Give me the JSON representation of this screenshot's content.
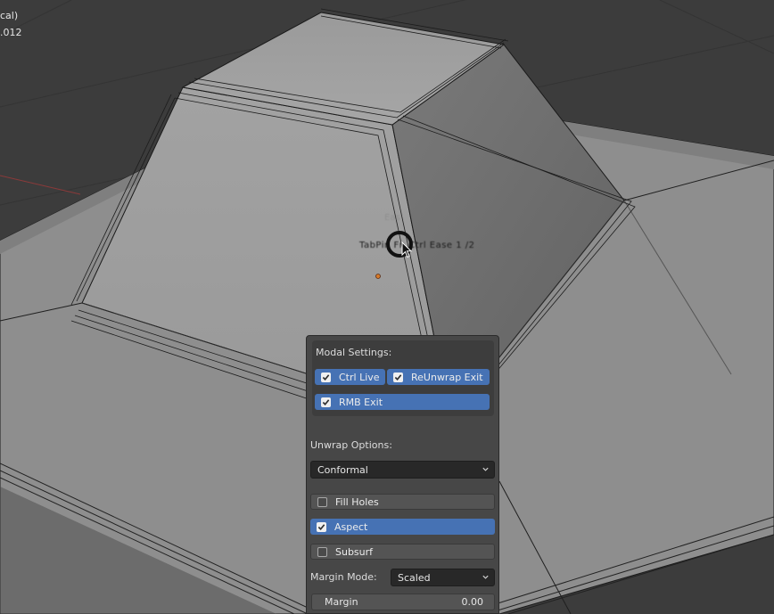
{
  "viewport": {
    "corner_line1": "cal)",
    "corner_line2": ".012",
    "ghost_title": "Eas",
    "ghost_shortcut": "TabPin  Fn Ctrl Ease  1  /2"
  },
  "panel": {
    "modal_settings_label": "Modal Settings:",
    "ctrl_live": {
      "label": "Ctrl Live",
      "checked": true
    },
    "reunwrap_exit": {
      "label": "ReUnwrap Exit",
      "checked": true
    },
    "rmb_exit": {
      "label": "RMB Exit",
      "checked": true
    },
    "unwrap_options_label": "Unwrap Options:",
    "unwrap_method": "Conformal",
    "fill_holes": {
      "label": "Fill Holes",
      "checked": false
    },
    "aspect": {
      "label": "Aspect",
      "checked": true
    },
    "subsurf": {
      "label": "Subsurf",
      "checked": false
    },
    "margin_mode_label": "Margin Mode:",
    "margin_mode": "Scaled",
    "margin_label": "Margin",
    "margin_value": "0.00"
  },
  "colors": {
    "accent": "#4672b4",
    "viewport_bg": "#3d3d3d",
    "panel_bg": "#474747"
  },
  "icons": {
    "cursor": "arrow-cursor-icon",
    "brush": "brush-ring-icon",
    "checkbox": "checkmark-icon",
    "dropdown": "chevron-down-icon"
  }
}
